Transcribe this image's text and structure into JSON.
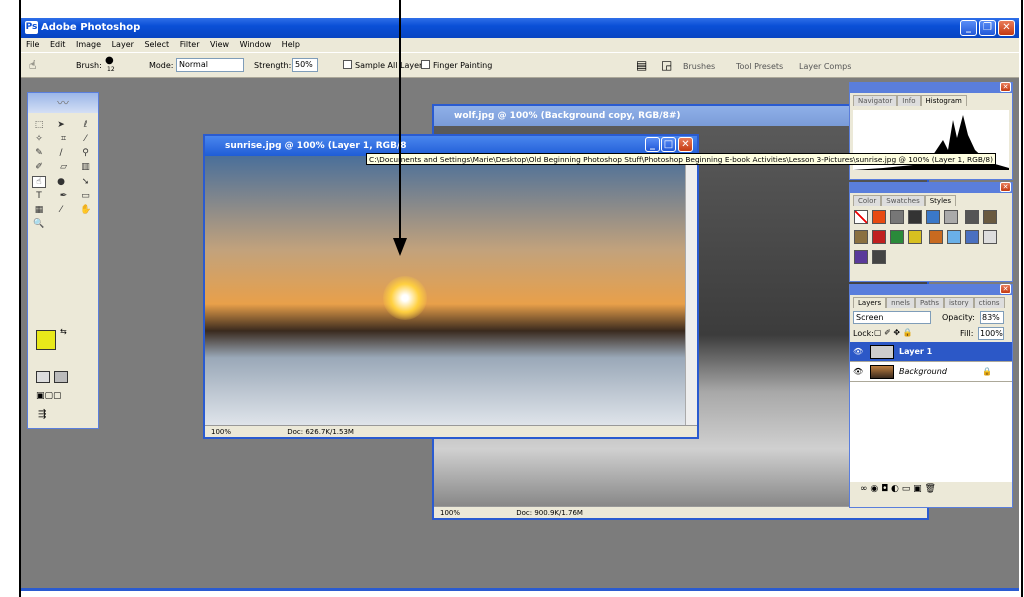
{
  "app": {
    "title": "Adobe Photoshop",
    "window_buttons": [
      "_",
      "❐",
      "✕"
    ]
  },
  "menu": [
    "File",
    "Edit",
    "Image",
    "Layer",
    "Select",
    "Filter",
    "View",
    "Window",
    "Help"
  ],
  "options_bar": {
    "brush_label": "Brush:",
    "brush_size": "12",
    "mode_label": "Mode:",
    "mode_value": "Normal",
    "strength_label": "Strength:",
    "strength_value": "50%",
    "sample_all_layers": "Sample All Layers",
    "finger_painting": "Finger Painting",
    "tabs": [
      "Brushes",
      "Tool Presets",
      "Layer Comps"
    ]
  },
  "wolf_window": {
    "title": "wolf.jpg @ 100% (Background copy, RGB/8#)",
    "zoom": "100%",
    "doc_info": "Doc: 900.9K/1.76M"
  },
  "sunrise_window": {
    "title": "sunrise.jpg @ 100% (Layer 1, RGB/8",
    "zoom": "100%",
    "doc_info": "Doc: 626.7K/1.53M"
  },
  "tooltip": "C:\\Documents and Settings\\Marie\\Desktop\\Old Beginning Photoshop Stuff\\Photoshop Beginning E-book Activities\\Lesson 3-Pictures\\sunrise.jpg @ 100% (Layer 1, RGB/8)",
  "navigator_panel": {
    "tabs": [
      "Navigator",
      "Info",
      "Histogram"
    ]
  },
  "color_panel": {
    "tabs": [
      "Color",
      "Swatches",
      "Styles"
    ]
  },
  "layers_panel": {
    "tabs": [
      "Layers",
      "nnels",
      "Paths",
      "istory",
      "ctions"
    ],
    "blend_mode": "Screen",
    "opacity_label": "Opacity:",
    "opacity_value": "83%",
    "lock_label": "Lock:",
    "fill_label": "Fill:",
    "fill_value": "100%",
    "layers": [
      {
        "name": "Layer 1"
      },
      {
        "name": "Background"
      }
    ]
  },
  "colors": {
    "titlebar": "#0a4fd6",
    "foreground_color": "#e8e81a",
    "background_color": "#ffffff"
  }
}
